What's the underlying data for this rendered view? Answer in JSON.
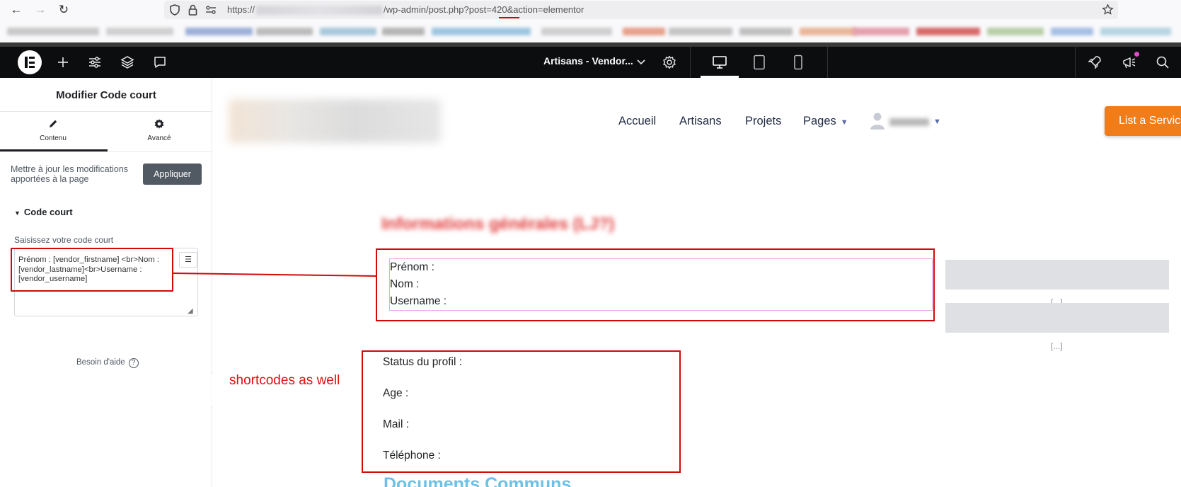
{
  "browser": {
    "url_prefix": "https://",
    "url_suffix": "/wp-admin/post.php?post=420&action=elementor"
  },
  "editor": {
    "page_title": "Artisans - Vendor...",
    "icons": [
      "elementor-logo-icon",
      "add-element-icon",
      "site-settings-icon",
      "structure-layers-icon",
      "notes-comment-icon",
      "page-settings-gear-icon",
      "desktop-icon",
      "tablet-icon",
      "mobile-icon",
      "publish-rocket-icon",
      "whats-new-megaphone-icon",
      "search-icon"
    ]
  },
  "panel": {
    "title": "Modifier Code court",
    "tabs": [
      {
        "label": "Contenu",
        "icon": "pencil-icon",
        "active": true
      },
      {
        "label": "Avancé",
        "icon": "gear-icon",
        "active": false
      }
    ],
    "update_notice": "Mettre à jour les modifications apportées à la page",
    "apply_label": "Appliquer",
    "section_title": "Code court",
    "field_label": "Saisissez votre code court",
    "shortcode_value": "Prénom : [vendor_firstname] <br>Nom : [vendor_lastname]<br>Username : [vendor_username]",
    "help_label": "Besoin d'aide"
  },
  "preview": {
    "menu": [
      {
        "label": "Accueil"
      },
      {
        "label": "Artisans"
      },
      {
        "label": "Projets"
      },
      {
        "label": "Pages"
      }
    ],
    "cta_label": "List a Servic",
    "fields_box1": [
      "Prénom :",
      "Nom :",
      "Username :"
    ],
    "fields_box2": [
      "Status du profil :",
      "Age :",
      "Mail :",
      "Téléphone :"
    ],
    "placeholder_dots": "[...]",
    "documents_heading": "Documents Communs"
  },
  "annotation": {
    "text": "shortcodes as well",
    "color": "#d00a0a"
  },
  "colors": {
    "elementor_bar": "#0c0d0e",
    "cta": "#f07d1a",
    "heading_link": "#6ec1e4"
  }
}
